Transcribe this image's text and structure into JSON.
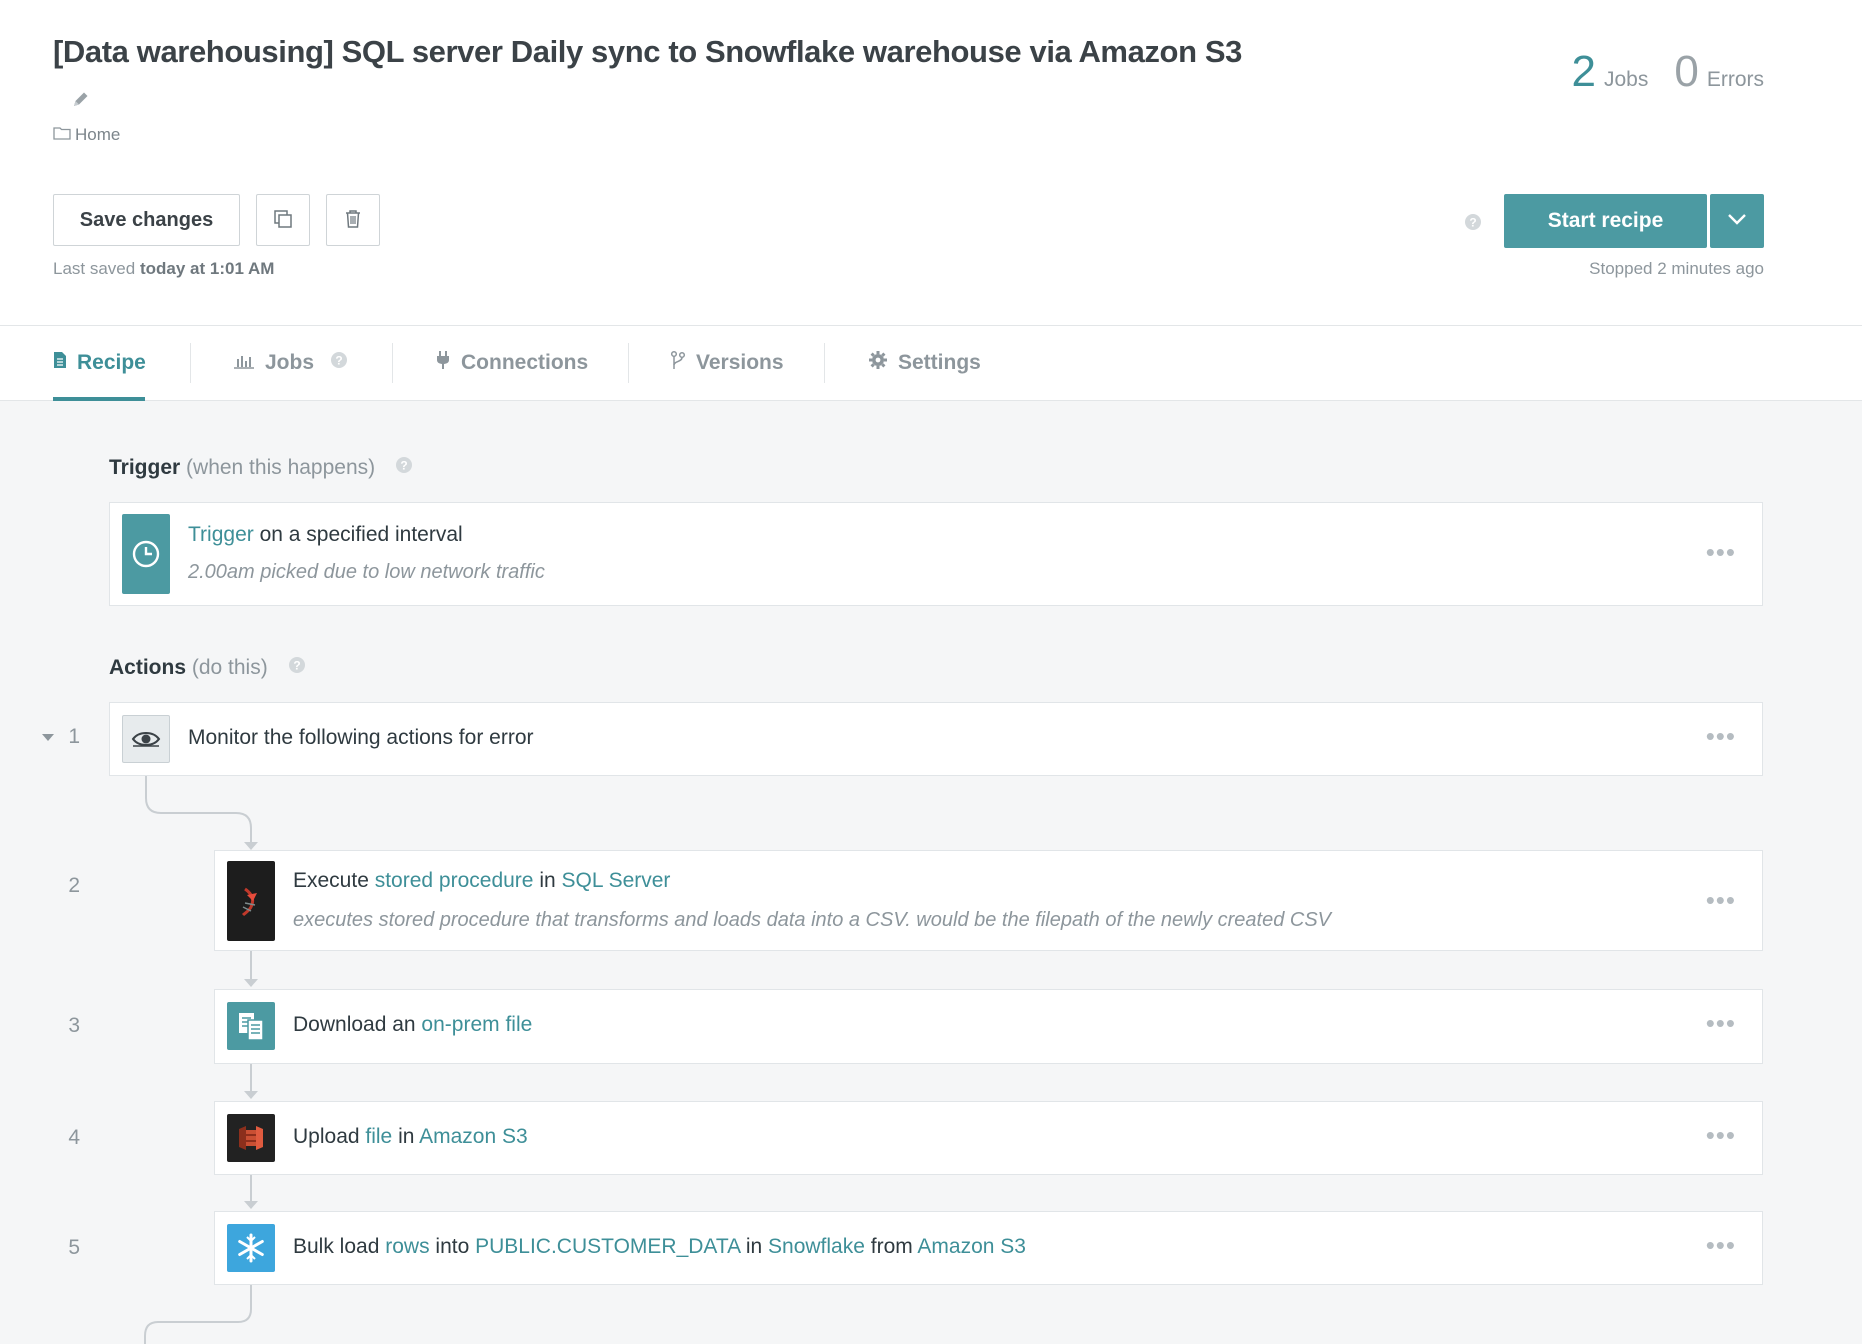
{
  "header": {
    "title": "[Data warehousing] SQL server Daily sync to Snowflake warehouse via Amazon S3",
    "breadcrumb": "Home",
    "stats": {
      "jobs_count": "2",
      "jobs_label": "Jobs",
      "errors_count": "0",
      "errors_label": "Errors"
    },
    "save_label": "Save changes",
    "last_saved_prefix": "Last saved",
    "last_saved_time": "today at 1:01 AM",
    "start_label": "Start recipe",
    "stopped_text": "Stopped 2 minutes ago"
  },
  "tabs": [
    {
      "label": "Recipe",
      "icon": "document-icon",
      "active": true
    },
    {
      "label": "Jobs",
      "icon": "bar-chart-icon"
    },
    {
      "label": "Connections",
      "icon": "plug-icon"
    },
    {
      "label": "Versions",
      "icon": "branch-icon"
    },
    {
      "label": "Settings",
      "icon": "gear-icon"
    }
  ],
  "trigger": {
    "label": "Trigger",
    "label_sub": "(when this happens)",
    "title_link": "Trigger",
    "title_rest": " on a specified interval",
    "description": "2.00am picked due to low network traffic"
  },
  "actions": {
    "label": "Actions",
    "label_sub": "(do this)",
    "steps": [
      {
        "num": "1",
        "text": "Monitor the following actions for error"
      },
      {
        "num": "2",
        "t1": "Execute ",
        "l1": "stored procedure",
        "t2": " in ",
        "l2": "SQL Server",
        "description": "executes stored procedure that transforms and loads data into a CSV. would be the filepath of the newly created CSV"
      },
      {
        "num": "3",
        "t1": "Download an ",
        "l1": "on-prem file"
      },
      {
        "num": "4",
        "t1": "Upload ",
        "l1": "file",
        "t2": " in ",
        "l2": "Amazon S3"
      },
      {
        "num": "5",
        "t1": "Bulk load ",
        "l1": "rows",
        "t2": " into ",
        "l2": "PUBLIC.CUSTOMER_DATA",
        "t3": " in ",
        "l3": "Snowflake",
        "t4": " from ",
        "l4": "Amazon S3"
      }
    ]
  },
  "colors": {
    "accent": "#3e8f98",
    "button": "#4c9aa2",
    "snowflake": "#3da6dd",
    "s3": "#c94f33"
  }
}
